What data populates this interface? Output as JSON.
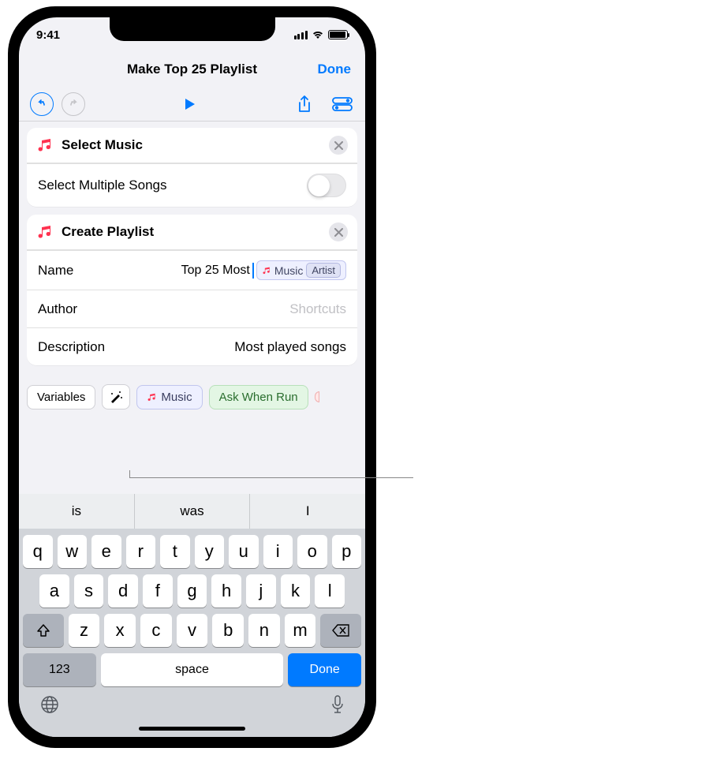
{
  "status": {
    "time": "9:41"
  },
  "nav": {
    "title": "Make Top 25 Playlist",
    "done": "Done"
  },
  "actions": {
    "select_music": {
      "title": "Select Music",
      "option_label": "Select Multiple Songs",
      "option_on": false
    },
    "create_playlist": {
      "title": "Create Playlist",
      "fields": {
        "name": {
          "label": "Name",
          "text": "Top 25 Most",
          "var_label": "Music",
          "var_detail": "Artist"
        },
        "author": {
          "label": "Author",
          "placeholder": "Shortcuts"
        },
        "description": {
          "label": "Description",
          "value": "Most played songs"
        }
      }
    }
  },
  "var_bar": {
    "variables": "Variables",
    "music": "Music",
    "ask": "Ask When Run"
  },
  "suggestions": [
    "is",
    "was",
    "I"
  ],
  "keyboard": {
    "row1": [
      "q",
      "w",
      "e",
      "r",
      "t",
      "y",
      "u",
      "i",
      "o",
      "p"
    ],
    "row2": [
      "a",
      "s",
      "d",
      "f",
      "g",
      "h",
      "j",
      "k",
      "l"
    ],
    "row3": [
      "z",
      "x",
      "c",
      "v",
      "b",
      "n",
      "m"
    ],
    "num": "123",
    "space": "space",
    "done": "Done"
  }
}
